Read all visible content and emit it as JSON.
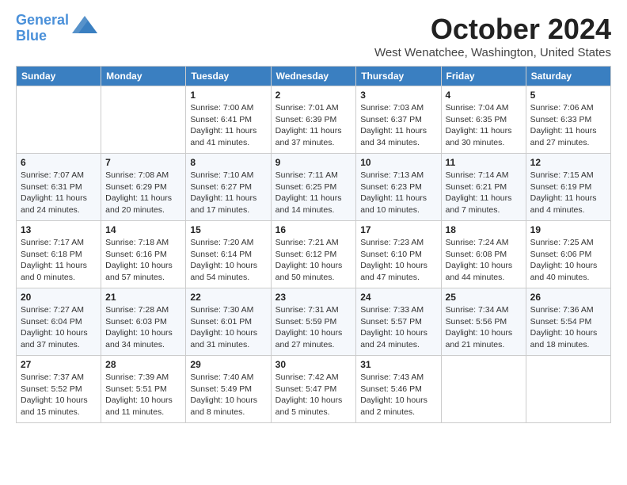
{
  "header": {
    "logo_line1": "General",
    "logo_line2": "Blue",
    "month_title": "October 2024",
    "location": "West Wenatchee, Washington, United States"
  },
  "weekdays": [
    "Sunday",
    "Monday",
    "Tuesday",
    "Wednesday",
    "Thursday",
    "Friday",
    "Saturday"
  ],
  "weeks": [
    [
      {
        "day": "",
        "info": ""
      },
      {
        "day": "",
        "info": ""
      },
      {
        "day": "1",
        "info": "Sunrise: 7:00 AM\nSunset: 6:41 PM\nDaylight: 11 hours and 41 minutes."
      },
      {
        "day": "2",
        "info": "Sunrise: 7:01 AM\nSunset: 6:39 PM\nDaylight: 11 hours and 37 minutes."
      },
      {
        "day": "3",
        "info": "Sunrise: 7:03 AM\nSunset: 6:37 PM\nDaylight: 11 hours and 34 minutes."
      },
      {
        "day": "4",
        "info": "Sunrise: 7:04 AM\nSunset: 6:35 PM\nDaylight: 11 hours and 30 minutes."
      },
      {
        "day": "5",
        "info": "Sunrise: 7:06 AM\nSunset: 6:33 PM\nDaylight: 11 hours and 27 minutes."
      }
    ],
    [
      {
        "day": "6",
        "info": "Sunrise: 7:07 AM\nSunset: 6:31 PM\nDaylight: 11 hours and 24 minutes."
      },
      {
        "day": "7",
        "info": "Sunrise: 7:08 AM\nSunset: 6:29 PM\nDaylight: 11 hours and 20 minutes."
      },
      {
        "day": "8",
        "info": "Sunrise: 7:10 AM\nSunset: 6:27 PM\nDaylight: 11 hours and 17 minutes."
      },
      {
        "day": "9",
        "info": "Sunrise: 7:11 AM\nSunset: 6:25 PM\nDaylight: 11 hours and 14 minutes."
      },
      {
        "day": "10",
        "info": "Sunrise: 7:13 AM\nSunset: 6:23 PM\nDaylight: 11 hours and 10 minutes."
      },
      {
        "day": "11",
        "info": "Sunrise: 7:14 AM\nSunset: 6:21 PM\nDaylight: 11 hours and 7 minutes."
      },
      {
        "day": "12",
        "info": "Sunrise: 7:15 AM\nSunset: 6:19 PM\nDaylight: 11 hours and 4 minutes."
      }
    ],
    [
      {
        "day": "13",
        "info": "Sunrise: 7:17 AM\nSunset: 6:18 PM\nDaylight: 11 hours and 0 minutes."
      },
      {
        "day": "14",
        "info": "Sunrise: 7:18 AM\nSunset: 6:16 PM\nDaylight: 10 hours and 57 minutes."
      },
      {
        "day": "15",
        "info": "Sunrise: 7:20 AM\nSunset: 6:14 PM\nDaylight: 10 hours and 54 minutes."
      },
      {
        "day": "16",
        "info": "Sunrise: 7:21 AM\nSunset: 6:12 PM\nDaylight: 10 hours and 50 minutes."
      },
      {
        "day": "17",
        "info": "Sunrise: 7:23 AM\nSunset: 6:10 PM\nDaylight: 10 hours and 47 minutes."
      },
      {
        "day": "18",
        "info": "Sunrise: 7:24 AM\nSunset: 6:08 PM\nDaylight: 10 hours and 44 minutes."
      },
      {
        "day": "19",
        "info": "Sunrise: 7:25 AM\nSunset: 6:06 PM\nDaylight: 10 hours and 40 minutes."
      }
    ],
    [
      {
        "day": "20",
        "info": "Sunrise: 7:27 AM\nSunset: 6:04 PM\nDaylight: 10 hours and 37 minutes."
      },
      {
        "day": "21",
        "info": "Sunrise: 7:28 AM\nSunset: 6:03 PM\nDaylight: 10 hours and 34 minutes."
      },
      {
        "day": "22",
        "info": "Sunrise: 7:30 AM\nSunset: 6:01 PM\nDaylight: 10 hours and 31 minutes."
      },
      {
        "day": "23",
        "info": "Sunrise: 7:31 AM\nSunset: 5:59 PM\nDaylight: 10 hours and 27 minutes."
      },
      {
        "day": "24",
        "info": "Sunrise: 7:33 AM\nSunset: 5:57 PM\nDaylight: 10 hours and 24 minutes."
      },
      {
        "day": "25",
        "info": "Sunrise: 7:34 AM\nSunset: 5:56 PM\nDaylight: 10 hours and 21 minutes."
      },
      {
        "day": "26",
        "info": "Sunrise: 7:36 AM\nSunset: 5:54 PM\nDaylight: 10 hours and 18 minutes."
      }
    ],
    [
      {
        "day": "27",
        "info": "Sunrise: 7:37 AM\nSunset: 5:52 PM\nDaylight: 10 hours and 15 minutes."
      },
      {
        "day": "28",
        "info": "Sunrise: 7:39 AM\nSunset: 5:51 PM\nDaylight: 10 hours and 11 minutes."
      },
      {
        "day": "29",
        "info": "Sunrise: 7:40 AM\nSunset: 5:49 PM\nDaylight: 10 hours and 8 minutes."
      },
      {
        "day": "30",
        "info": "Sunrise: 7:42 AM\nSunset: 5:47 PM\nDaylight: 10 hours and 5 minutes."
      },
      {
        "day": "31",
        "info": "Sunrise: 7:43 AM\nSunset: 5:46 PM\nDaylight: 10 hours and 2 minutes."
      },
      {
        "day": "",
        "info": ""
      },
      {
        "day": "",
        "info": ""
      }
    ]
  ]
}
